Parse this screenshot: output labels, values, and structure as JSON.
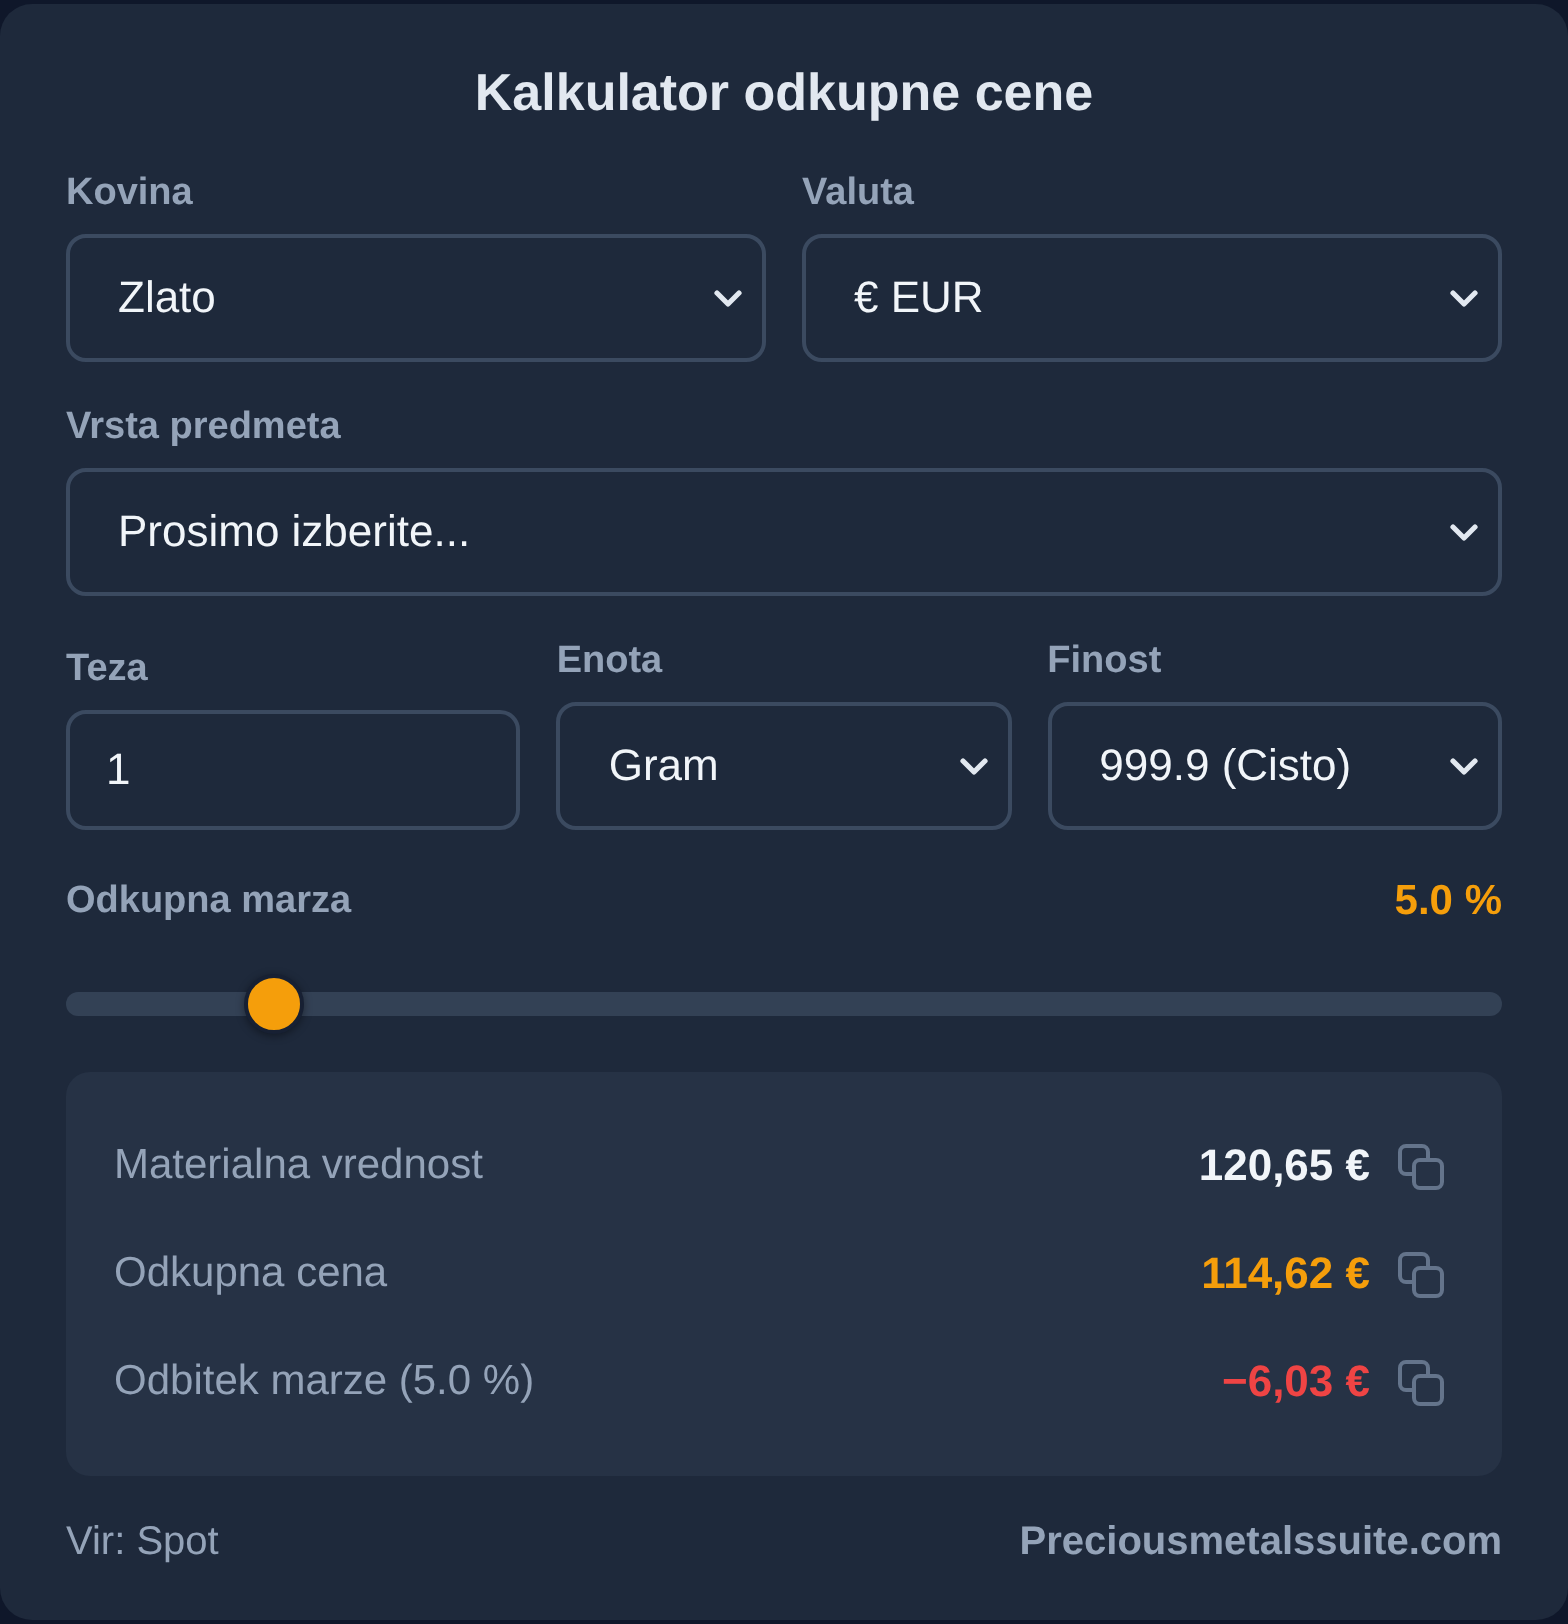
{
  "title": "Kalkulator odkupne cene",
  "field_rows": [
    {
      "fields": [
        {
          "kind": "select",
          "label": "Kovina",
          "value": "Zlato"
        },
        {
          "kind": "select",
          "label": "Valuta",
          "value": "€ EUR"
        }
      ]
    },
    {
      "fields": [
        {
          "kind": "select",
          "label": "Vrsta predmeta",
          "value": "Prosimo izberite..."
        }
      ]
    },
    {
      "fields": [
        {
          "kind": "input",
          "label": "Teza",
          "value": "1"
        },
        {
          "kind": "select",
          "label": "Enota",
          "value": "Gram"
        },
        {
          "kind": "select",
          "label": "Finost",
          "value": "999.9 (Cisto)"
        }
      ]
    }
  ],
  "margin": {
    "label": "Odkupna marza",
    "reading": "5.0 %",
    "level": 0.13
  },
  "results": [
    {
      "label": "Materialna vrednost",
      "value": "120,65 €",
      "color": "#f1f5f9"
    },
    {
      "label": "Odkupna cena",
      "value": "114,62 €",
      "color": "#f59e0b"
    },
    {
      "label": "Odbitek marze (5.0 %)",
      "value": "−6,03 €",
      "color": "#ef4444"
    }
  ],
  "footer": {
    "source": "Vir: Spot",
    "brand": "Preciousmetalssuite.com"
  }
}
